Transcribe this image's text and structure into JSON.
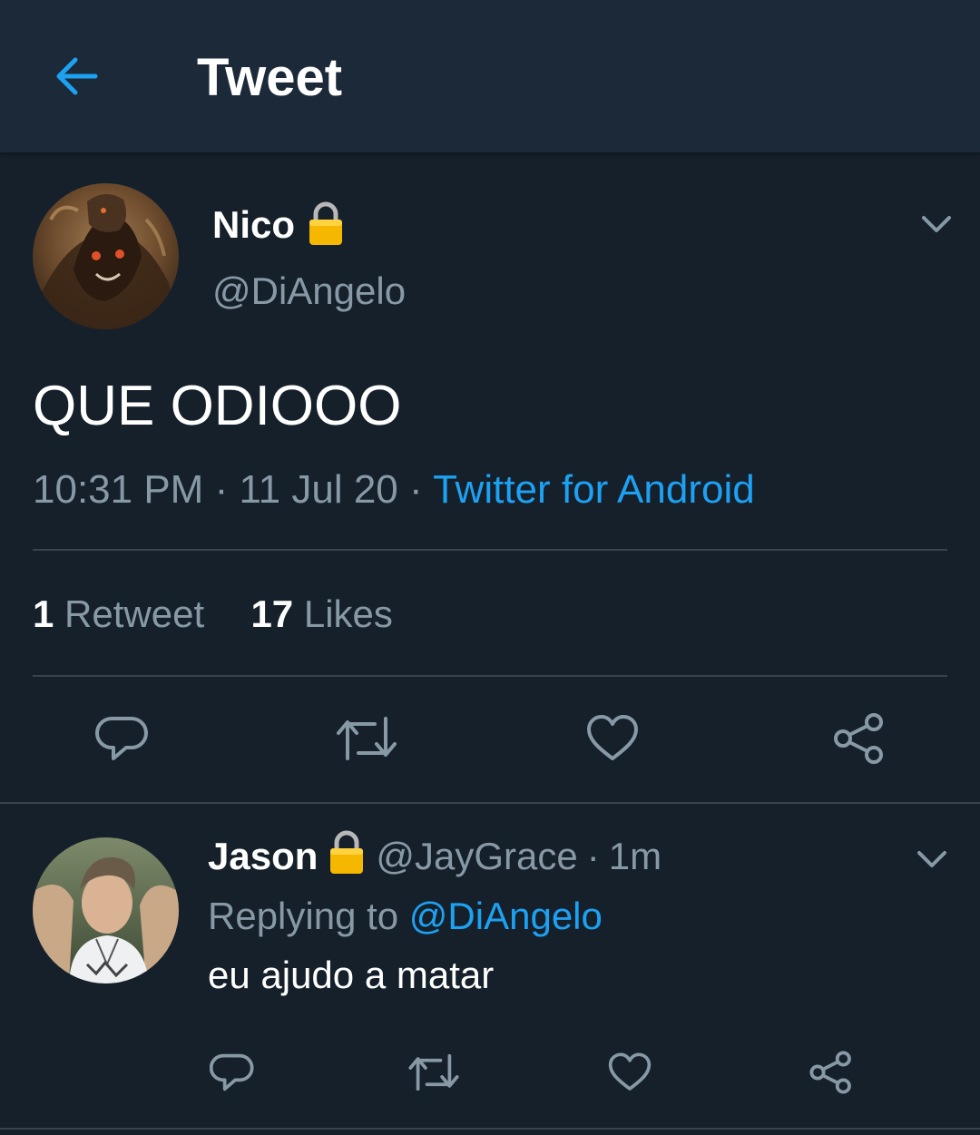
{
  "header": {
    "title": "Tweet"
  },
  "tweet": {
    "display_name": "Nico",
    "handle": "@DiAngelo",
    "text": "QUE ODIOOO",
    "time": "10:31 PM",
    "date": "11 Jul 20",
    "separator": "·",
    "source": "Twitter for Android",
    "retweet_count": "1",
    "retweet_label": "Retweet",
    "like_count": "17",
    "like_label": "Likes"
  },
  "reply": {
    "display_name": "Jason",
    "handle": "@JayGrace",
    "separator": "·",
    "age": "1m",
    "replying_prefix": "Replying to",
    "replying_to": "@DiAngelo",
    "text": "eu ajudo a matar"
  },
  "icons": {
    "back": "arrow-left-icon",
    "lock": "lock-icon",
    "chevron": "chevron-down-icon",
    "reply": "reply-icon",
    "retweet": "retweet-icon",
    "like": "heart-icon",
    "share": "share-icon"
  },
  "colors": {
    "background": "#15202b",
    "header_background": "#1c2938",
    "accent": "#1da1f2",
    "muted_text": "#8899a6",
    "divider": "#38444d"
  }
}
